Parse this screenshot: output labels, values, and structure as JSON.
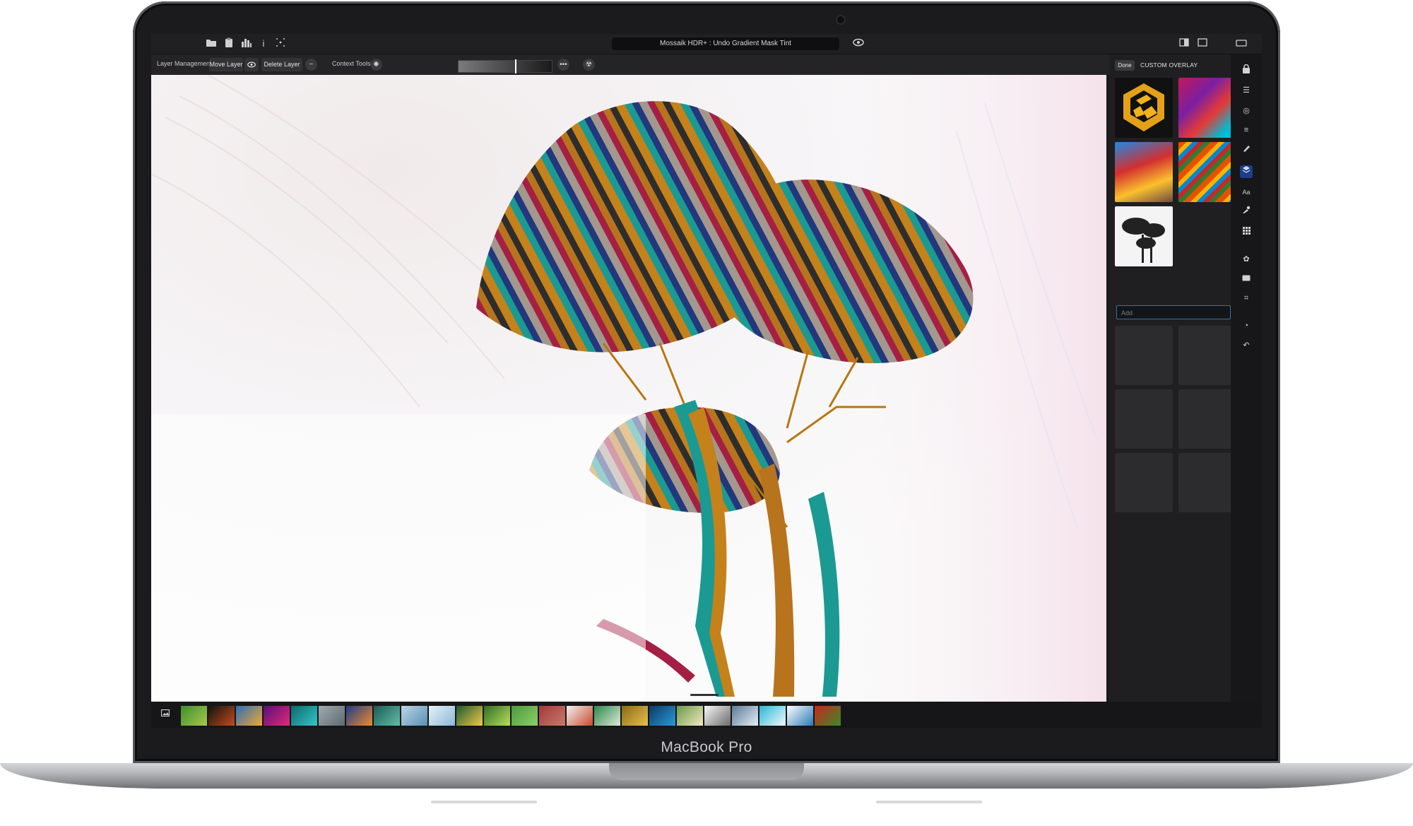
{
  "device": {
    "brand_label": "MacBook Pro"
  },
  "titlebar": {
    "title": "Mossaik HDR+ : Undo Gradient Mask Tint",
    "left_icons": [
      "folder-icon",
      "clipboard-icon",
      "histogram-icon",
      "info-icon",
      "sparkle-icon"
    ],
    "right_icons": [
      "eye-icon",
      "split-view-icon",
      "single-view-icon",
      "window-icon"
    ]
  },
  "toolbar": {
    "layer_management_label": "Layer Management",
    "move_layer_label": "Move Layer",
    "delete_layer_label": "Delete Layer",
    "context_tools_label": "Context Tools"
  },
  "panel": {
    "done_label": "Done",
    "title": "CUSTOM OVERLAY",
    "add_placeholder": "Add",
    "overlay_thumbs": [
      "logo-overlay",
      "paint-splash-overlay",
      "city-painting-overlay",
      "streak-overlay",
      "tree-silhouette-overlay"
    ]
  },
  "rail": {
    "icons": [
      "lock-icon",
      "menu-icon",
      "target-icon",
      "filter-icon",
      "brush-icon",
      "layers-icon",
      "text-icon",
      "eyedropper-icon",
      "grid-icon",
      "flower-icon",
      "card-icon",
      "crop-icon",
      "clock-icon",
      "undo-icon"
    ],
    "active": "layers-icon"
  },
  "colors": {
    "accent": "#3b6ea5",
    "active_rail": "#1d3f8a",
    "app_background": "#1f1f21"
  }
}
